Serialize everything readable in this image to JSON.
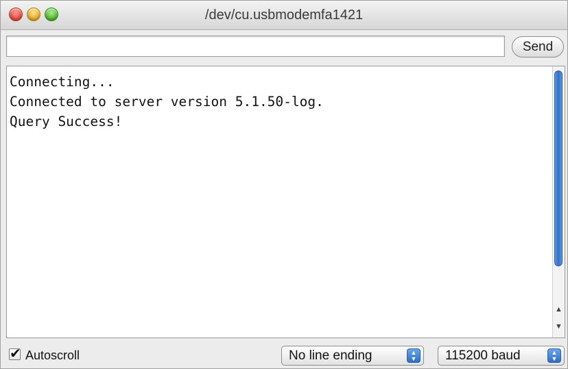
{
  "window": {
    "title": "/dev/cu.usbmodemfa1421"
  },
  "toolbar": {
    "input_value": "",
    "send_label": "Send"
  },
  "output": {
    "lines": [
      "Connecting...",
      "Connected to server version 5.1.50-log.",
      "Query Success!"
    ]
  },
  "footer": {
    "autoscroll_label": "Autoscroll",
    "autoscroll_checked": true,
    "line_ending": "No line ending",
    "baud_rate": "115200 baud"
  },
  "icons": {
    "close": "close-icon",
    "minimize": "minimize-icon",
    "zoom": "zoom-icon",
    "checkmark": "checkmark-icon",
    "stepper": "stepper-icon"
  }
}
